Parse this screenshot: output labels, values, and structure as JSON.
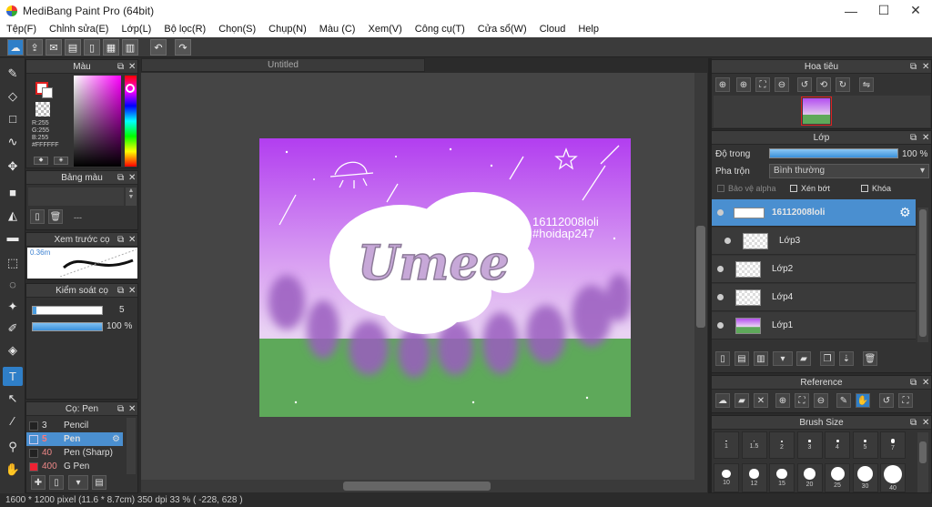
{
  "window": {
    "title": "MediBang Paint Pro (64bit)",
    "minimize": "—",
    "maximize": "☐",
    "close": "✕"
  },
  "menu": [
    "Tệp(F)",
    "Chỉnh sửa(E)",
    "Lớp(L)",
    "Bộ lọc(R)",
    "Chọn(S)",
    "Chụp(N)",
    "Màu (C)",
    "Xem(V)",
    "Công cụ(T)",
    "Cửa sổ(W)",
    "Cloud",
    "Help"
  ],
  "toolbar": {
    "icons": [
      "cloud-icon",
      "upload-icon",
      "comment-icon",
      "comment-list-icon",
      "document-icon",
      "panel-icon",
      "grid-icon",
      "undo-icon",
      "redo-icon"
    ]
  },
  "color_panel": {
    "title": "Màu",
    "r": "R:255",
    "g": "G:255",
    "b": "B:255",
    "hex": "#FFFFFF"
  },
  "palette_panel": {
    "title": "Bảng màu",
    "dash": "---"
  },
  "preview_panel": {
    "title": "Xem trước cọ",
    "size": "0.36m"
  },
  "brush_control": {
    "title": "Kiểm soát cọ",
    "size_value": "5",
    "opacity_value": "100 %"
  },
  "brush_panel": {
    "title": "Cọ: Pen",
    "items": [
      {
        "size": "3",
        "name": "Pencil"
      },
      {
        "size": "5",
        "name": "Pen"
      },
      {
        "size": "40",
        "name": "Pen (Sharp)"
      },
      {
        "size": "400",
        "name": "G Pen"
      }
    ]
  },
  "document": {
    "tab": "Untitled"
  },
  "artwork": {
    "title": "Umee",
    "caption_line1": "16112008loli",
    "caption_line2": "#hoidap247"
  },
  "navigator": {
    "title": "Hoa tiêu"
  },
  "layers": {
    "title": "Lớp",
    "opacity_label": "Độ trong",
    "opacity_value": "100 %",
    "opacity_fraction": 1.0,
    "blend_label": "Pha trộn",
    "blend_value": "Bình thường",
    "protect_alpha": "Bảo vệ alpha",
    "clip": "Xén bớt",
    "lock": "Khóa",
    "rows": [
      {
        "name": "16112008loli",
        "selected": true
      },
      {
        "name": "Lớp3",
        "selected": false
      },
      {
        "name": "Lớp2",
        "selected": false
      },
      {
        "name": "Lớp4",
        "selected": false
      },
      {
        "name": "Lớp1",
        "selected": false
      }
    ]
  },
  "reference": {
    "title": "Reference"
  },
  "brush_size": {
    "title": "Brush Size",
    "row1": [
      "1",
      "1.5",
      "2",
      "3",
      "4",
      "5",
      "7"
    ],
    "row2": [
      "10",
      "12",
      "15",
      "20",
      "25",
      "30",
      "40"
    ]
  },
  "status": {
    "text": "1600 * 1200 pixel   (11.6 * 8.7cm)   350 dpi   33 %   ( -228, 628 )"
  }
}
